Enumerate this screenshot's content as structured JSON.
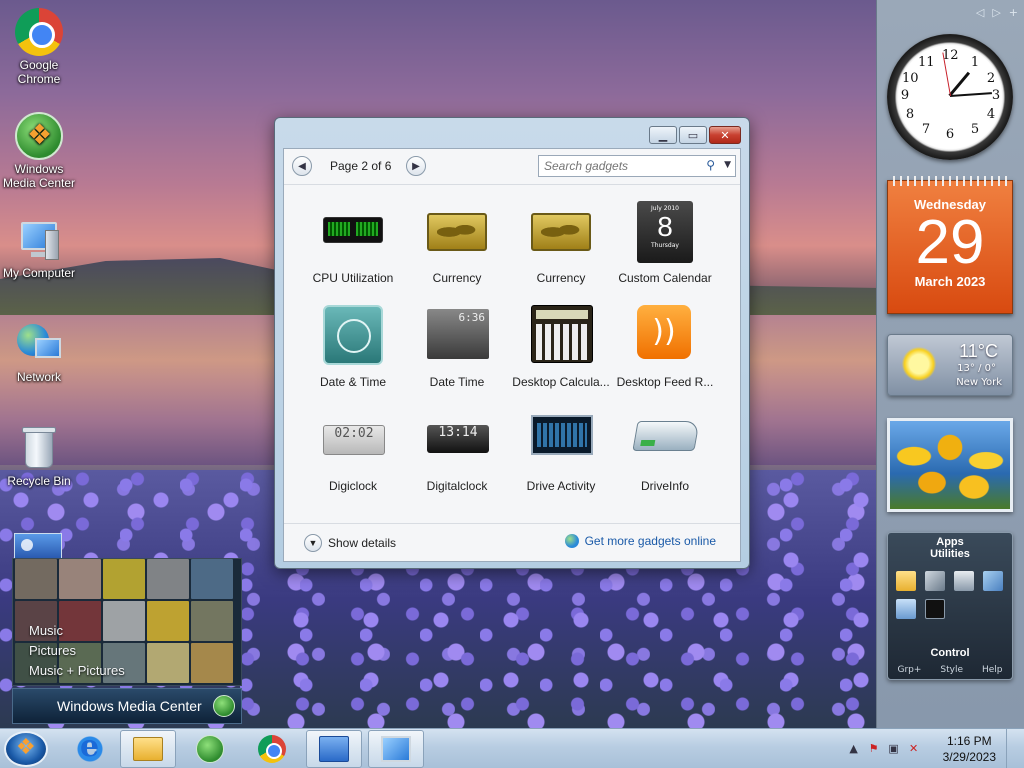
{
  "desktop": {
    "icons": [
      {
        "label": "Google Chrome"
      },
      {
        "label": "Windows Media Center"
      },
      {
        "label": "My Computer"
      },
      {
        "label": "Network"
      },
      {
        "label": "Recycle Bin"
      }
    ]
  },
  "gadget_window": {
    "page_label": "Page 2 of 6",
    "search_placeholder": "Search gadgets",
    "gadgets": [
      {
        "name": "CPU Utilization",
        "icon": "cpu-meter-icon"
      },
      {
        "name": "Currency",
        "icon": "currency-icon"
      },
      {
        "name": "Currency",
        "icon": "currency-icon"
      },
      {
        "name": "Custom Calendar",
        "icon": "calendar-icon",
        "thumb_month": "July 2010",
        "thumb_day": "8",
        "thumb_weekday": "Thursday"
      },
      {
        "name": "Date & Time",
        "icon": "clock-icon"
      },
      {
        "name": "Date Time",
        "icon": "flip-clock-icon",
        "thumb_text": "6:36"
      },
      {
        "name": "Desktop Calcula...",
        "icon": "calculator-icon"
      },
      {
        "name": "Desktop Feed R...",
        "icon": "rss-feed-icon",
        "thumb_text": "))"
      },
      {
        "name": "Digiclock",
        "icon": "digital-clock-icon",
        "thumb_text": "02:02"
      },
      {
        "name": "Digitalclock",
        "icon": "digital-clock-icon",
        "thumb_text": "13:14"
      },
      {
        "name": "Drive Activity",
        "icon": "drive-activity-icon"
      },
      {
        "name": "DriveInfo",
        "icon": "hard-drive-icon"
      }
    ],
    "show_details": "Show details",
    "get_more": "Get more gadgets online"
  },
  "sidebar": {
    "clock_numbers": [
      "12",
      "1",
      "2",
      "3",
      "4",
      "5",
      "6",
      "7",
      "8",
      "9",
      "10",
      "11"
    ],
    "calendar": {
      "weekday": "Wednesday",
      "day": "29",
      "month_year": "March 2023"
    },
    "weather": {
      "temp": "11°C",
      "hilo": "13° / 0°",
      "city": "New York"
    },
    "apps": {
      "title": "Apps",
      "subtitle": "Utilities",
      "control": "Control",
      "options": [
        "Grp+",
        "Style",
        "Help"
      ]
    }
  },
  "media_center": {
    "menu": [
      "Music",
      "Pictures",
      "Music + Pictures"
    ],
    "bar_label": "Windows Media Center"
  },
  "taskbar": {
    "time": "1:16 PM",
    "date": "3/29/2023"
  }
}
